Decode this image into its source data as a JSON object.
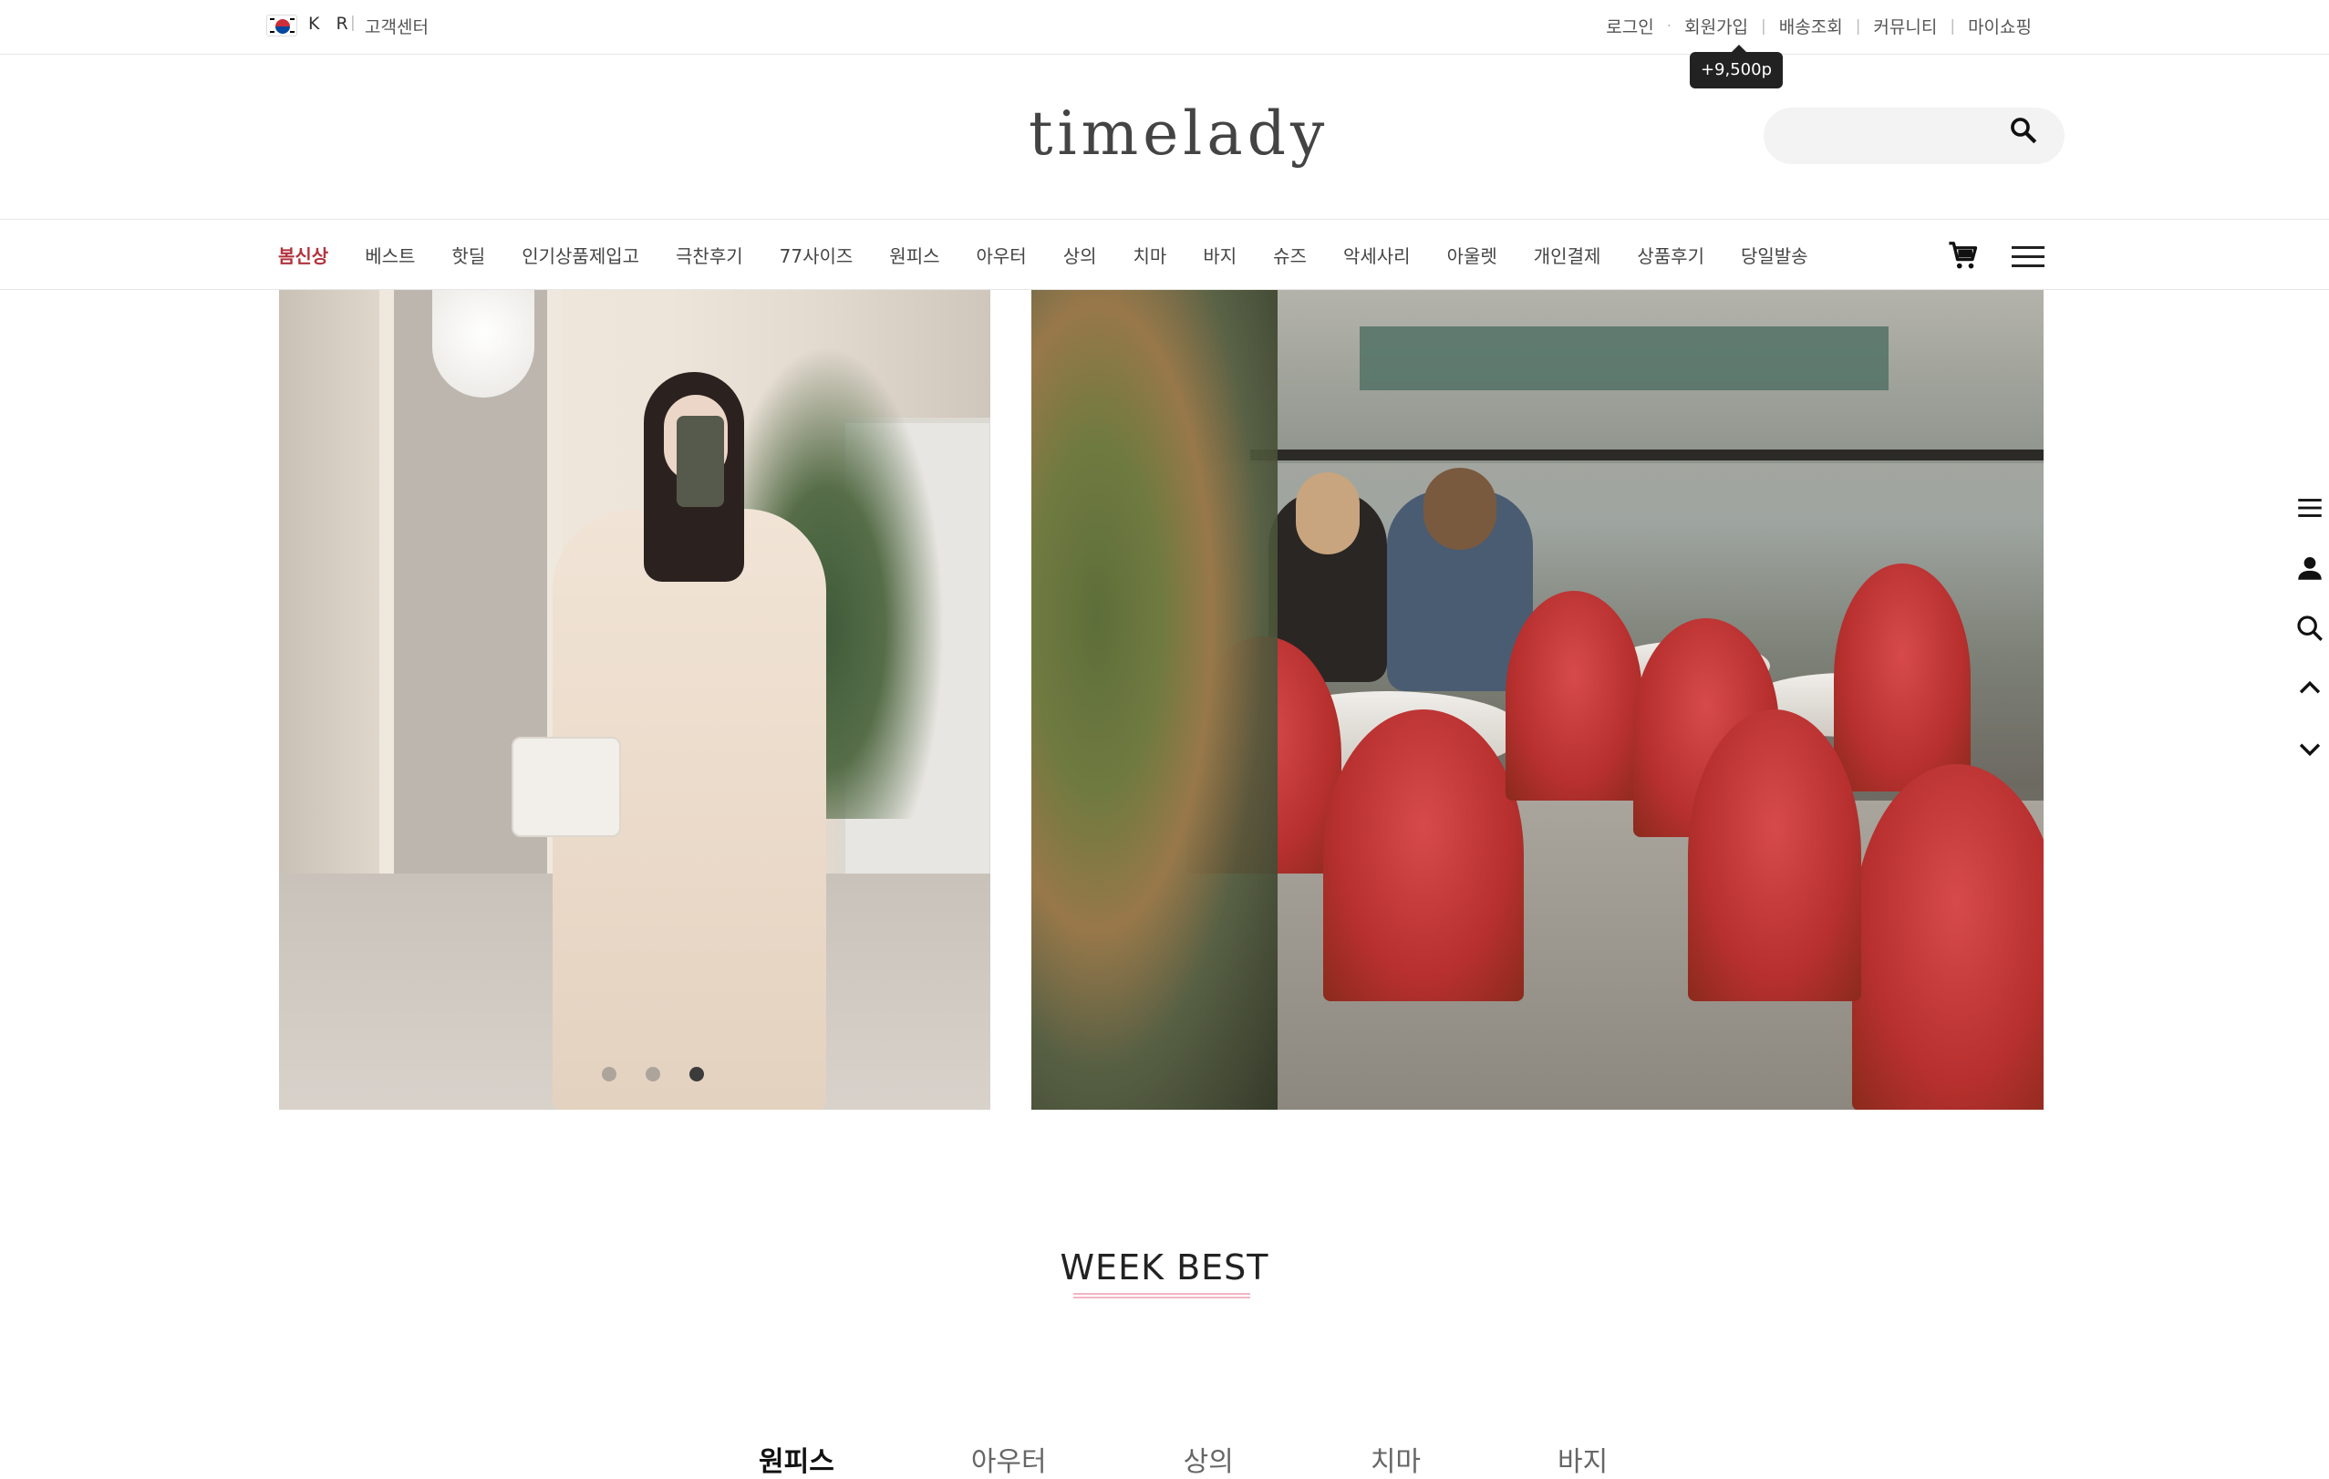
{
  "topbar": {
    "lang": "K R",
    "customer_center": "고객센터",
    "links": [
      {
        "label": "로그인"
      },
      {
        "label": "회원가입"
      },
      {
        "label": "배송조회"
      },
      {
        "label": "커뮤니티"
      },
      {
        "label": "마이쇼핑"
      }
    ],
    "join_points_tooltip": "+9,500p"
  },
  "header": {
    "logo": "timelady",
    "search_placeholder": ""
  },
  "nav": {
    "items": [
      {
        "label": "봄신상",
        "active": true
      },
      {
        "label": "베스트"
      },
      {
        "label": "핫딜"
      },
      {
        "label": "인기상품제입고"
      },
      {
        "label": "극찬후기"
      },
      {
        "label": "77사이즈"
      },
      {
        "label": "원피스"
      },
      {
        "label": "아우터"
      },
      {
        "label": "상의"
      },
      {
        "label": "치마"
      },
      {
        "label": "바지"
      },
      {
        "label": "슈즈"
      },
      {
        "label": "악세사리"
      },
      {
        "label": "아울렛"
      },
      {
        "label": "개인결제"
      },
      {
        "label": "상품후기"
      },
      {
        "label": "당일발송"
      }
    ]
  },
  "hero": {
    "slider_pages": 3,
    "active_slide": 3
  },
  "week_best": {
    "title": "WEEK BEST",
    "tabs": [
      {
        "label": "원피스",
        "active": true
      },
      {
        "label": "아우터"
      },
      {
        "label": "상의"
      },
      {
        "label": "치마"
      },
      {
        "label": "바지"
      }
    ]
  },
  "quick_bar": [
    "menu-icon",
    "user-icon",
    "search-icon",
    "chevron-up-icon",
    "chevron-down-icon"
  ],
  "colors": {
    "accent": "#b2333d",
    "title_underline": "#f3b6c4"
  }
}
